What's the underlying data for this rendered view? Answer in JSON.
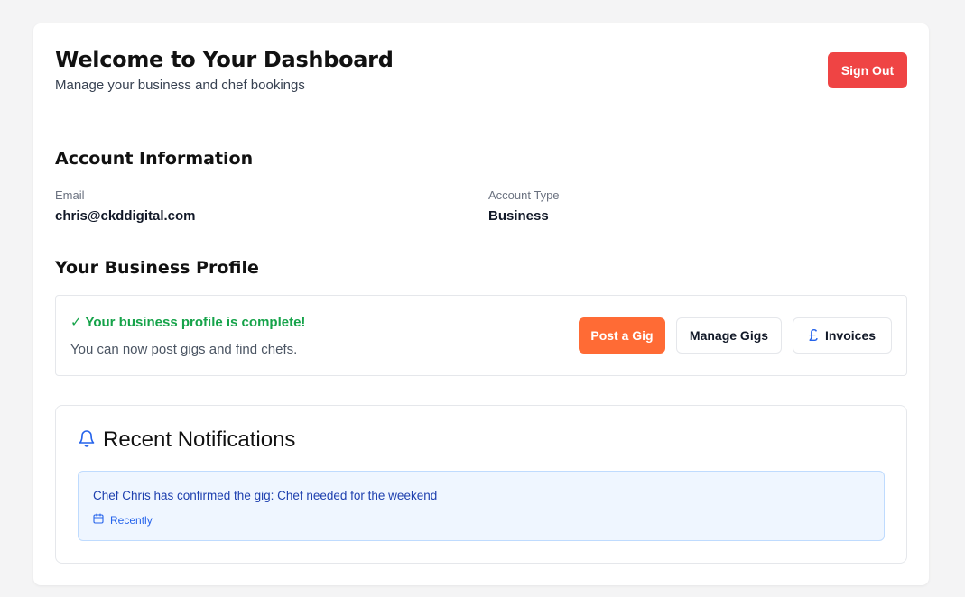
{
  "header": {
    "title": "Welcome to Your Dashboard",
    "subtitle": "Manage your business and chef bookings",
    "sign_out_label": "Sign Out"
  },
  "account": {
    "section_title": "Account Information",
    "email_label": "Email",
    "email_value": "chris@ckddigital.com",
    "type_label": "Account Type",
    "type_value": "Business"
  },
  "business_profile": {
    "section_title": "Your Business Profile",
    "status": "✓ Your business profile is complete!",
    "description": "You can now post gigs and find chefs.",
    "post_gig_label": "Post a Gig",
    "manage_gigs_label": "Manage Gigs",
    "invoices_label": "Invoices",
    "invoices_icon": "pound-icon"
  },
  "notifications": {
    "title": "Recent Notifications",
    "icon": "bell-icon",
    "items": [
      {
        "message": "Chef Chris has confirmed the gig: Chef needed for the weekend",
        "time": "Recently",
        "icon": "calendar-icon"
      }
    ]
  },
  "colors": {
    "sign_out": "#ef4444",
    "post_gig": "#ff6b35",
    "success": "#16a34a",
    "notification_bg": "#eff6ff",
    "notification_text": "#1e40af"
  }
}
